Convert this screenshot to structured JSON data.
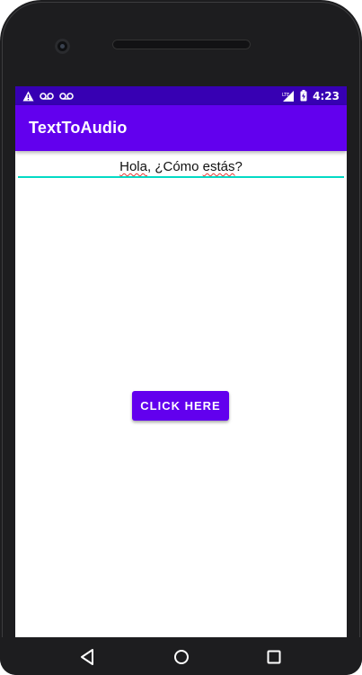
{
  "statusbar": {
    "time": "4:23",
    "left_icons": [
      "warning-icon",
      "voicemail-icon",
      "voicemail-icon"
    ],
    "right_icons": [
      "lte-signal-icon",
      "battery-charging-icon"
    ]
  },
  "appbar": {
    "title": "TextToAudio"
  },
  "text_input": {
    "value_part1": "Hola",
    "value_part2": ", ¿Cómo ",
    "value_part3": "estás",
    "value_part4": "?"
  },
  "main": {
    "button_label": "CLICK HERE"
  },
  "navbar": {
    "icons": [
      "back-icon",
      "home-icon",
      "recents-icon"
    ]
  },
  "colors": {
    "statusbar": "#3700b3",
    "primary": "#6200ee",
    "accent": "#03dac5"
  }
}
